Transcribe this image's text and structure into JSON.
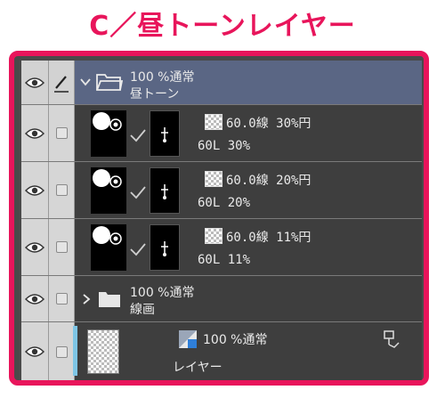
{
  "page": {
    "title": "C／昼トーンレイヤー"
  },
  "folder_top": {
    "blend": "100 %通常",
    "name": "昼トーン",
    "expanded": true
  },
  "sublayers": [
    {
      "tone": "60.0線 30%円",
      "label": "60L 30%"
    },
    {
      "tone": "60.0線 20%円",
      "label": "60L 20%"
    },
    {
      "tone": "60.0線 11%円",
      "label": "60L 11%"
    }
  ],
  "folder2": {
    "blend": "100 %通常",
    "name": "線画",
    "expanded": false
  },
  "layer": {
    "blend": "100 %通常",
    "name": "レイヤー"
  },
  "colors": {
    "accent": "#e8155b",
    "selected_row": "#5a6684",
    "layer_color_bar": "#7fc6e6"
  }
}
